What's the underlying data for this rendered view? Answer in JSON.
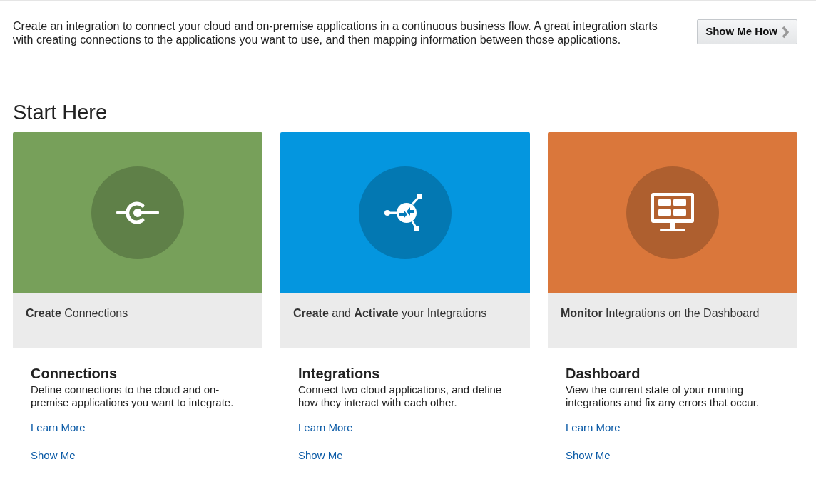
{
  "intro": {
    "text": "Create an integration to connect your cloud and on-premise applications in a continuous business flow. A great integration starts with creating connections to the applications you want to use, and then mapping information between those applications.",
    "button": "Show Me How"
  },
  "heading": "Start Here",
  "cards": [
    {
      "kind": "connections",
      "color": "#77a05a",
      "caption": "**Create** Connections",
      "title": "Connections",
      "description": "Define connections to the cloud and on-premise applications you want to integrate.",
      "links": [
        "Learn More",
        "Show Me"
      ]
    },
    {
      "kind": "integrations",
      "color": "#0496df",
      "caption": "**Create** and **Activate** your Integrations",
      "title": "Integrations",
      "description": "Connect two cloud applications, and define how they interact with each other.",
      "links": [
        "Learn More",
        "Show Me"
      ]
    },
    {
      "kind": "dashboard",
      "color": "#da773b",
      "caption": "**Monitor** Integrations on the Dashboard",
      "title": "Dashboard",
      "description": "View the current state of your running integrations and fix any errors that occur.",
      "links": [
        "Learn More",
        "Show Me"
      ]
    }
  ]
}
